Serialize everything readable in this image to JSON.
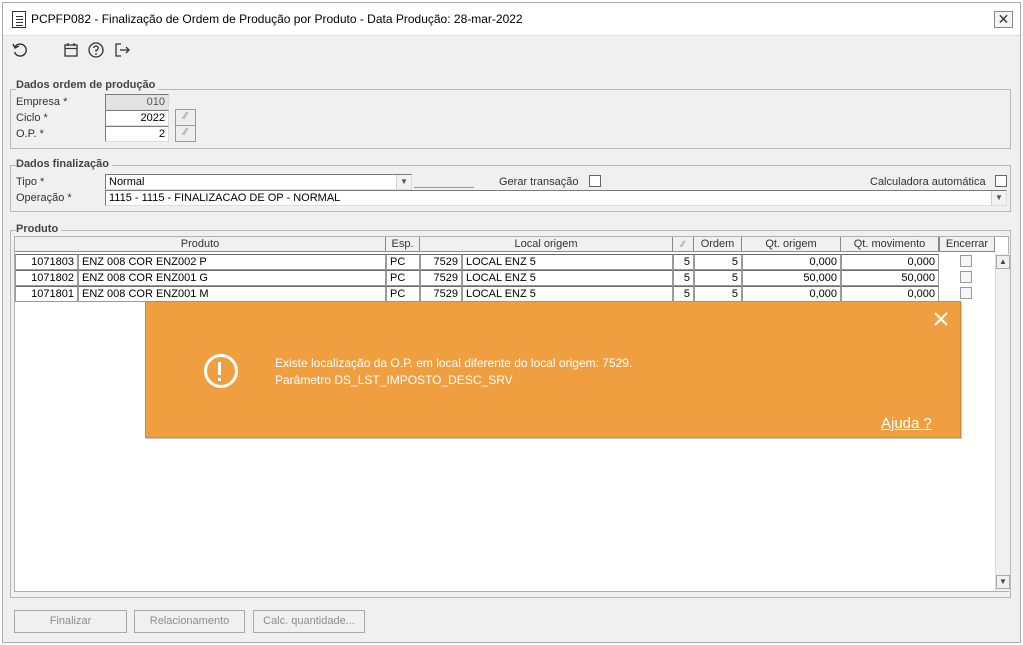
{
  "window": {
    "title": "PCPFP082 - Finalização de Ordem de Produção por Produto - Data Produção: 28-mar-2022",
    "close_glyph": "✕"
  },
  "toolbar": {
    "icons": [
      "refresh-icon",
      "calendar-icon",
      "help-icon",
      "exit-icon"
    ]
  },
  "dados_ordem": {
    "title": "Dados ordem de produção",
    "empresa_label": "Empresa *",
    "empresa_value": "010",
    "ciclo_label": "Ciclo *",
    "ciclo_value": "2022",
    "op_label": "O.P. *",
    "op_value": "2"
  },
  "dados_finalizacao": {
    "title": "Dados finalização",
    "tipo_label": "Tipo *",
    "tipo_value": "Normal",
    "gerar_transacao_label": "Gerar transação",
    "calculadora_label": "Calculadora automática",
    "operacao_label": "Operação *",
    "operacao_value": "1115 - 1115 - FINALIZACAO DE OP - NORMAL"
  },
  "produto": {
    "title": "Produto",
    "columns": {
      "produto": "Produto",
      "esp": "Esp.",
      "local_origem": "Local origem",
      "ordem": "Ordem",
      "qt_origem": "Qt. origem",
      "qt_movimento": "Qt. movimento",
      "encerrar": "Encerrar"
    },
    "rows": [
      {
        "codigo": "1071803",
        "descricao": "ENZ 008 COR ENZ002 P",
        "esp": "PC",
        "local_cod": "7529",
        "local_nome": "LOCAL ENZ 5",
        "lookup": "5",
        "ordem": "5",
        "qt_origem": "0,000",
        "qt_movimento": "0,000"
      },
      {
        "codigo": "1071802",
        "descricao": "ENZ 008 COR ENZ001 G",
        "esp": "PC",
        "local_cod": "7529",
        "local_nome": "LOCAL ENZ 5",
        "lookup": "5",
        "ordem": "5",
        "qt_origem": "50,000",
        "qt_movimento": "50,000"
      },
      {
        "codigo": "1071801",
        "descricao": "ENZ 008 COR ENZ001 M",
        "esp": "PC",
        "local_cod": "7529",
        "local_nome": "LOCAL ENZ 5",
        "lookup": "5",
        "ordem": "5",
        "qt_origem": "0,000",
        "qt_movimento": "0,000"
      }
    ]
  },
  "alert": {
    "line1": "Existe localização da O.P. em local diferente do local origem: 7529.",
    "line2": "Parâmetro DS_LST_IMPOSTO_DESC_SRV",
    "link": "Ajuda ?",
    "color": "#ef9f3f"
  },
  "buttons": {
    "finalizar": "Finalizar",
    "relacionamento": "Relacionamento",
    "calc_quantidade": "Calc. quantidade..."
  }
}
